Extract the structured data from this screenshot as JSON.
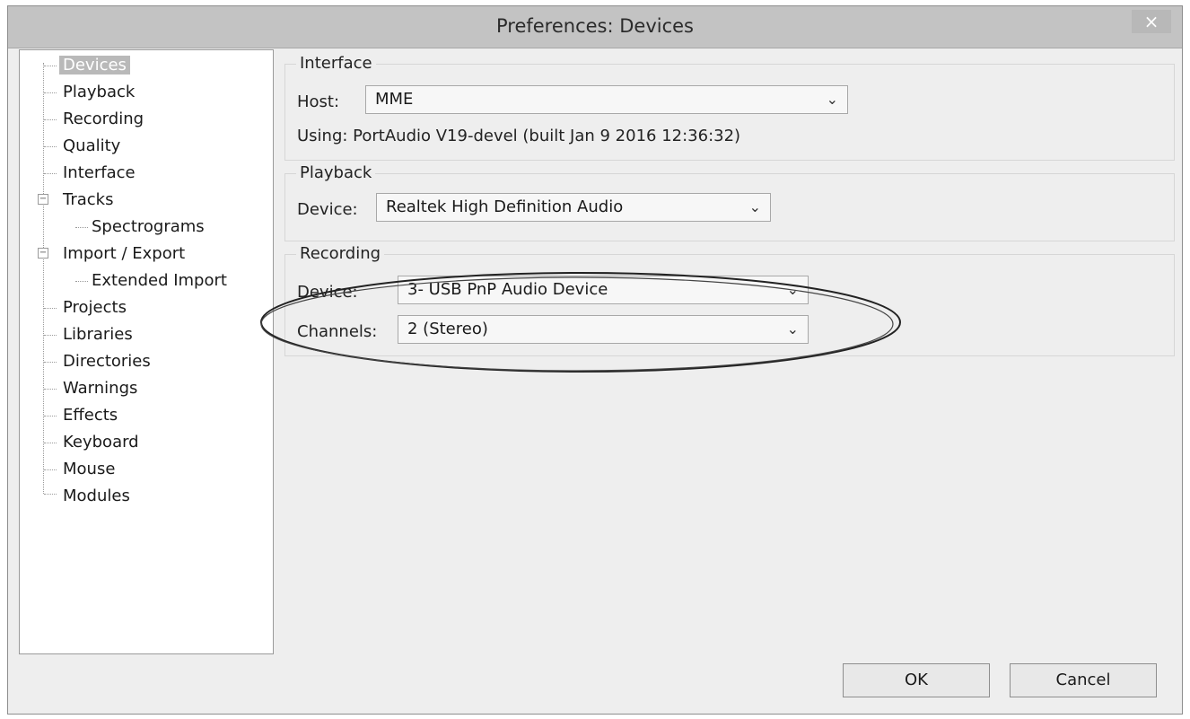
{
  "window": {
    "title": "Preferences: Devices",
    "close_glyph": "×"
  },
  "sidebar": {
    "items": [
      {
        "label": "Devices",
        "selected": true
      },
      {
        "label": "Playback"
      },
      {
        "label": "Recording"
      },
      {
        "label": "Quality"
      },
      {
        "label": "Interface"
      },
      {
        "label": "Tracks",
        "expanded": true
      },
      {
        "label": "Spectrograms"
      },
      {
        "label": "Import / Export",
        "expanded": true
      },
      {
        "label": "Extended Import"
      },
      {
        "label": "Projects"
      },
      {
        "label": "Libraries"
      },
      {
        "label": "Directories"
      },
      {
        "label": "Warnings"
      },
      {
        "label": "Effects"
      },
      {
        "label": "Keyboard"
      },
      {
        "label": "Mouse"
      },
      {
        "label": "Modules"
      }
    ]
  },
  "interface": {
    "group_label": "Interface",
    "host_label": "Host:",
    "host_value": "MME",
    "using_text": "Using: PortAudio V19-devel (built Jan  9 2016 12:36:32)"
  },
  "playback": {
    "group_label": "Playback",
    "device_label": "Device:",
    "device_value": "Realtek High Definition Audio"
  },
  "recording": {
    "group_label": "Recording",
    "device_label": "Device:",
    "device_value": "3- USB PnP Audio Device",
    "channels_label": "Channels:",
    "channels_value": "2 (Stereo)"
  },
  "buttons": {
    "ok": "OK",
    "cancel": "Cancel"
  },
  "icons": {
    "dropdown": "chevron-down-icon",
    "close": "close-icon"
  }
}
